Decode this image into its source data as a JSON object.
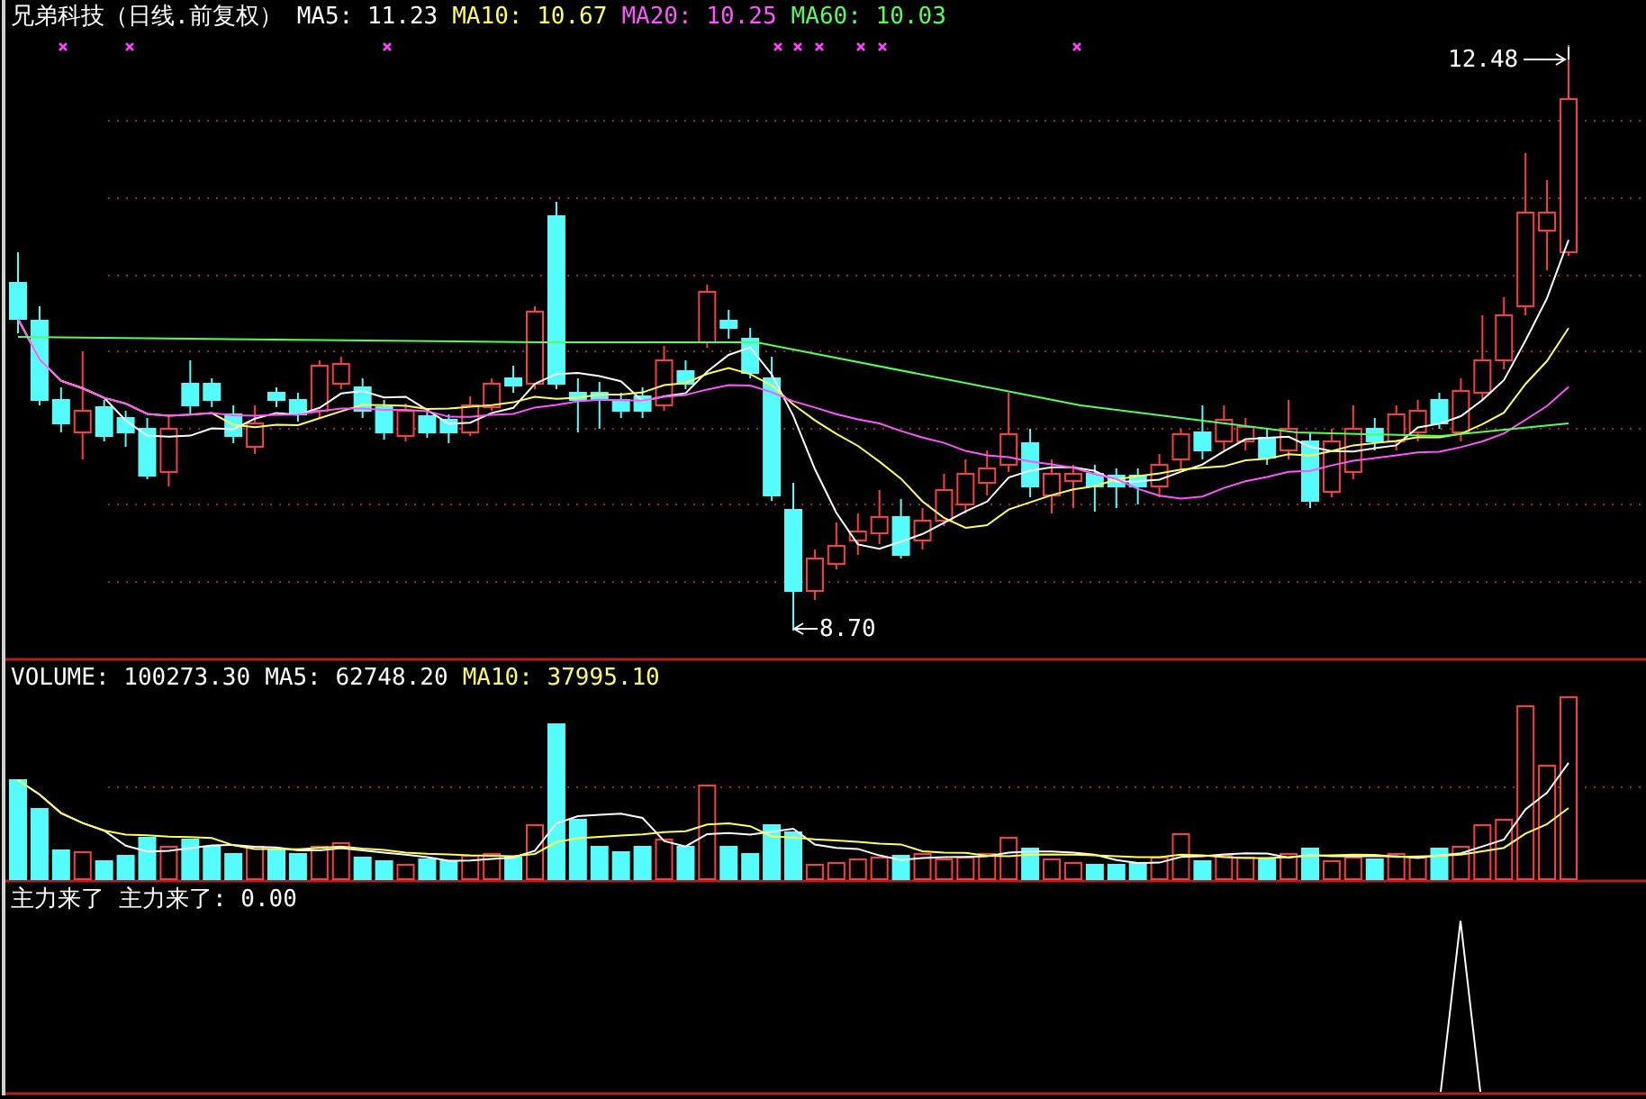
{
  "window": {
    "title": "兄弟科技（日线.前复权）"
  },
  "price_panel": {
    "indicators": [
      {
        "label": "MA5: 11.23",
        "color": "#ffffff"
      },
      {
        "label": "MA10: 10.67",
        "color": "#ffff54"
      },
      {
        "label": "MA20: 10.25",
        "color": "#ff54ff"
      },
      {
        "label": "MA60: 10.03",
        "color": "#54ff54"
      }
    ],
    "high_label": "12.48",
    "low_label": "8.70"
  },
  "volume_panel": {
    "indicators": [
      {
        "label": "VOLUME: 100273.30",
        "color": "#ffffff"
      },
      {
        "label": "MA5: 62748.20",
        "color": "#ffffff"
      },
      {
        "label": "MA10: 37995.10",
        "color": "#ffff54"
      }
    ]
  },
  "signal_panel": {
    "name": "主力来了",
    "indicators": [
      {
        "label": "主力来了: 0.00",
        "color": "#ffffff"
      }
    ]
  }
}
